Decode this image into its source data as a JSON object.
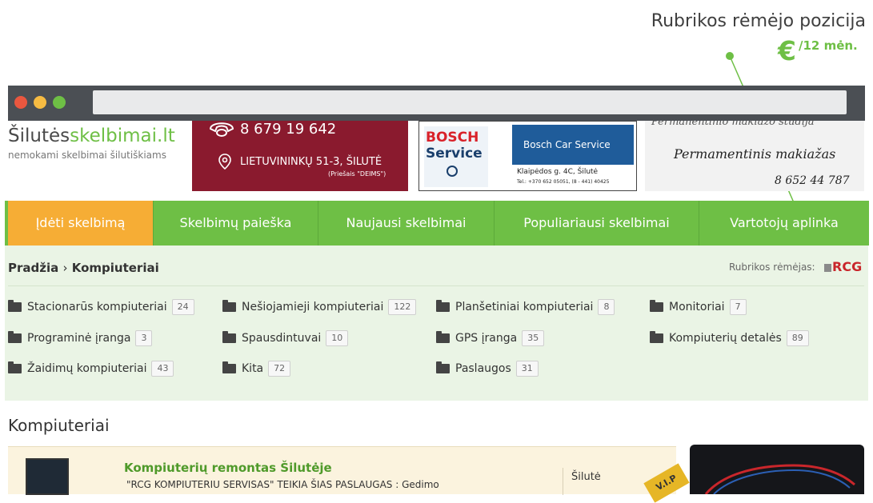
{
  "annotation": {
    "title": "Rubrikos rėmėjo pozicija",
    "price_symbol": "€",
    "price_period": "/12 mėn."
  },
  "header": {
    "logo_part1": "Šilutės",
    "logo_part2": "skelbimai.lt",
    "logo_tagline": "nemokami skelbimai šilutiškiams"
  },
  "ads": {
    "ad1": {
      "phone": "8 679 19 642",
      "address": "LIETUVININKŲ 51-3, ŠILUTĖ",
      "note": "(Priešais \"DEIMS\")"
    },
    "ad2": {
      "brand1": "BOSCH",
      "brand2": "Service",
      "banner": "Bosch Car Service",
      "address": "Klaipėdos g. 4C, Šilutė",
      "phones": "Tel.: +370 652 05051, (8 - 441) 40425"
    },
    "ad3": {
      "top": "Permanentinio makiažo studija",
      "title": "Permamentinis makiažas",
      "phone": "8 652 44 787"
    }
  },
  "nav": {
    "items": [
      "Įdėti skelbimą",
      "Skelbimų paieška",
      "Naujausi skelbimai",
      "Populiariausi skelbimai",
      "Vartotojų aplinka"
    ]
  },
  "breadcrumb": {
    "home": "Pradžia",
    "separator": "›",
    "current": "Kompiuteriai"
  },
  "sponsor": {
    "label": "Rubrikos rėmėjas:",
    "logo": "RCG"
  },
  "categories": [
    {
      "name": "Stacionarūs kompiuteriai",
      "count": "24"
    },
    {
      "name": "Nešiojamieji kompiuteriai",
      "count": "122"
    },
    {
      "name": "Planšetiniai kompiuteriai",
      "count": "8"
    },
    {
      "name": "Monitoriai",
      "count": "7"
    },
    {
      "name": "Programinė įranga",
      "count": "3"
    },
    {
      "name": "Spausdintuvai",
      "count": "10"
    },
    {
      "name": "GPS įranga",
      "count": "35"
    },
    {
      "name": "Kompiuterių detalės",
      "count": "89"
    },
    {
      "name": "Žaidimų kompiuteriai",
      "count": "43"
    },
    {
      "name": "Kita",
      "count": "72"
    },
    {
      "name": "Paslaugos",
      "count": "31"
    }
  ],
  "section": {
    "title": "Kompiuteriai"
  },
  "listing": {
    "title": "Kompiuterių remontas Šilutėje",
    "description": "\"RCG KOMPIUTERIU SERVISAS\" TEIKIA ŠIAS PASLAUGAS : Gedimo",
    "city": "Šilutė",
    "badge": "V.I.P"
  },
  "colors": {
    "green": "#6ebf45",
    "orange": "#f6ad35",
    "panel": "#eaf4e5",
    "chrome": "#4b4f54"
  }
}
